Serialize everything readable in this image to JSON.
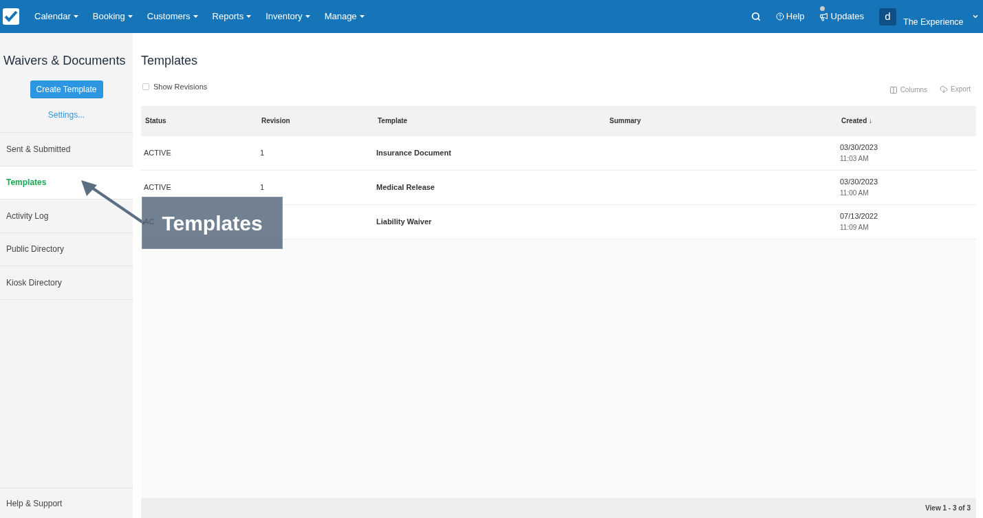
{
  "nav": {
    "items": [
      {
        "label": "Calendar"
      },
      {
        "label": "Booking"
      },
      {
        "label": "Customers"
      },
      {
        "label": "Reports"
      },
      {
        "label": "Inventory"
      },
      {
        "label": "Manage"
      }
    ],
    "help": "Help",
    "updates": "Updates",
    "avatar": "d",
    "account": "The Experience"
  },
  "sidebar": {
    "title": "Waivers & Documents",
    "create_button": "Create Template",
    "settings_link": "Settings...",
    "items": [
      {
        "label": "Sent & Submitted",
        "selected": false
      },
      {
        "label": "Templates",
        "selected": true
      },
      {
        "label": "Activity Log",
        "selected": false
      },
      {
        "label": "Public Directory",
        "selected": false
      },
      {
        "label": "Kiosk Directory",
        "selected": false
      }
    ],
    "footer": "Help & Support"
  },
  "main": {
    "title": "Templates",
    "show_revisions": {
      "label": "Show Revisions",
      "checked": false
    },
    "columns_button": "Columns",
    "export_button": "Export"
  },
  "table": {
    "columns": [
      "Status",
      "Revision",
      "Template",
      "Summary",
      "Created ↓"
    ],
    "rows": [
      {
        "status": "ACTIVE",
        "revision": "1",
        "template": "Insurance Document",
        "date": "03/30/2023",
        "time": "11:03 AM"
      },
      {
        "status": "ACTIVE",
        "revision": "1",
        "template": "Medical Release",
        "date": "03/30/2023",
        "time": "11:00 AM"
      },
      {
        "status": "AC",
        "template": "Liability Waiver",
        "date": "07/13/2022",
        "time": "11:09 AM"
      }
    ],
    "footer": "View 1 - 3 of 3"
  },
  "callout": {
    "label": "Templates"
  }
}
